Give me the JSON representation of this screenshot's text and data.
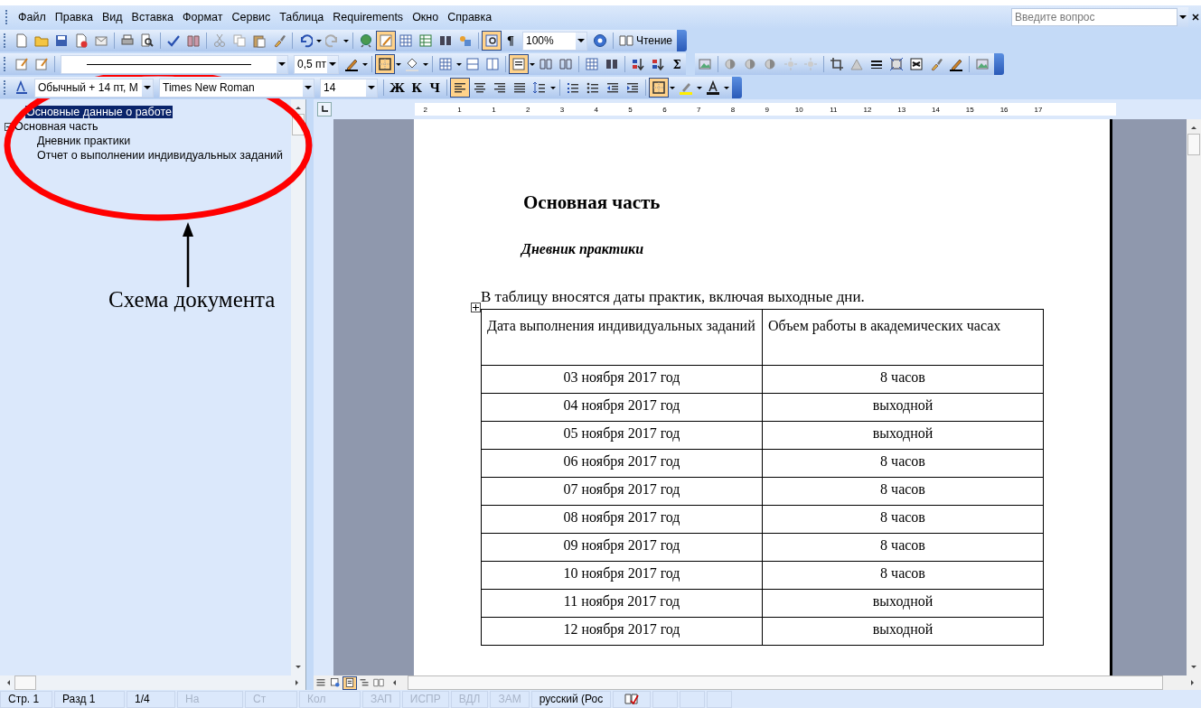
{
  "menu": [
    "Файл",
    "Правка",
    "Вид",
    "Вставка",
    "Формат",
    "Сервис",
    "Таблица",
    "Requirements",
    "Окно",
    "Справка"
  ],
  "help_search": {
    "placeholder": "Введите вопрос"
  },
  "toolbars": [
    {
      "items": [
        {
          "kind": "new",
          "selected": false
        },
        {
          "kind": "open",
          "selected": false
        },
        {
          "kind": "save",
          "selected": false
        },
        {
          "kind": "permission",
          "selected": false
        },
        {
          "kind": "email",
          "selected": false
        },
        {
          "kind": "sep"
        },
        {
          "kind": "print",
          "selected": false
        },
        {
          "kind": "preview",
          "selected": false
        },
        {
          "kind": "sep"
        },
        {
          "kind": "spelling",
          "selected": false
        },
        {
          "kind": "research",
          "selected": false
        },
        {
          "kind": "sep"
        },
        {
          "kind": "cut",
          "selected": false
        },
        {
          "kind": "copy",
          "selected": false
        },
        {
          "kind": "paste",
          "selected": false
        },
        {
          "kind": "brush",
          "selected": false
        },
        {
          "kind": "sep"
        },
        {
          "kind": "undo",
          "selected": false
        },
        {
          "kind": "arrow"
        },
        {
          "kind": "redo",
          "selected": false
        },
        {
          "kind": "arrow"
        },
        {
          "kind": "sep"
        },
        {
          "kind": "globe",
          "selected": false
        },
        {
          "kind": "tablepen",
          "selected": true
        },
        {
          "kind": "table",
          "selected": false
        },
        {
          "kind": "excel",
          "selected": false
        },
        {
          "kind": "columns",
          "selected": false
        },
        {
          "kind": "drawing",
          "selected": false
        },
        {
          "kind": "sep"
        },
        {
          "kind": "docmap",
          "selected": true
        },
        {
          "kind": "text",
          "label": "¶",
          "selected": false
        },
        {
          "kind": "field",
          "value": "100%"
        },
        {
          "kind": "help",
          "selected": false
        },
        {
          "kind": "sep"
        },
        {
          "kind": "reading",
          "label": "Чтение",
          "selected": false
        }
      ]
    },
    {
      "items": [
        {
          "kind": "form",
          "selected": false
        },
        {
          "kind": "form",
          "selected": false
        },
        {
          "kind": "sep"
        },
        {
          "kind": "linefield"
        },
        {
          "kind": "field",
          "value": "0,5 пт"
        },
        {
          "kind": "pen",
          "selected": false
        },
        {
          "kind": "arrow"
        },
        {
          "kind": "sep"
        },
        {
          "kind": "border",
          "selected": true
        },
        {
          "kind": "arrow"
        },
        {
          "kind": "bucket",
          "selected": false
        },
        {
          "kind": "arrow"
        },
        {
          "kind": "sep"
        },
        {
          "kind": "table",
          "selected": false
        },
        {
          "kind": "arrow"
        },
        {
          "kind": "merge",
          "selected": false
        },
        {
          "kind": "split",
          "selected": false
        },
        {
          "kind": "sep"
        },
        {
          "kind": "align",
          "selected": true
        },
        {
          "kind": "arrow"
        },
        {
          "kind": "distribute",
          "selected": false
        },
        {
          "kind": "distribute",
          "selected": false
        },
        {
          "kind": "sep"
        },
        {
          "kind": "table",
          "selected": false
        },
        {
          "kind": "columns",
          "selected": false
        },
        {
          "kind": "sep"
        },
        {
          "kind": "sortup",
          "selected": false
        },
        {
          "kind": "sortdown",
          "selected": false
        },
        {
          "kind": "text",
          "label": "Σ",
          "selected": false
        },
        {
          "kind": "gap"
        },
        {
          "kind": "picture",
          "selected": false
        },
        {
          "kind": "sep"
        },
        {
          "kind": "contrast",
          "selected": false
        },
        {
          "kind": "contrast",
          "selected": false
        },
        {
          "kind": "contrast",
          "selected": false
        },
        {
          "kind": "sun",
          "selected": false
        },
        {
          "kind": "sun",
          "selected": false
        },
        {
          "kind": "sep"
        },
        {
          "kind": "crop",
          "selected": false
        },
        {
          "kind": "rotate",
          "selected": false
        },
        {
          "kind": "lines",
          "selected": false
        },
        {
          "kind": "compress",
          "selected": false
        },
        {
          "kind": "wrap",
          "selected": false
        },
        {
          "kind": "brush",
          "selected": false
        },
        {
          "kind": "pen",
          "selected": false
        },
        {
          "kind": "sep"
        },
        {
          "kind": "picture",
          "selected": false
        }
      ]
    },
    {
      "items": [
        {
          "kind": "styles",
          "selected": false
        },
        {
          "kind": "field",
          "value": "Обычный + 14 пт, М"
        },
        {
          "kind": "field",
          "value": "Times New Roman"
        },
        {
          "kind": "field",
          "value": "14"
        },
        {
          "kind": "sep"
        },
        {
          "kind": "text",
          "label": "Ж",
          "selected": false
        },
        {
          "kind": "text",
          "label": "К",
          "selected": false
        },
        {
          "kind": "text",
          "label": "Ч",
          "selected": false
        },
        {
          "kind": "sep"
        },
        {
          "kind": "alignleft",
          "selected": true
        },
        {
          "kind": "aligncenter",
          "selected": false
        },
        {
          "kind": "alignright",
          "selected": false
        },
        {
          "kind": "justify",
          "selected": false
        },
        {
          "kind": "spacing",
          "selected": false
        },
        {
          "kind": "arrow"
        },
        {
          "kind": "sep"
        },
        {
          "kind": "numbering",
          "selected": false
        },
        {
          "kind": "bullets",
          "selected": false
        },
        {
          "kind": "outdent",
          "selected": false
        },
        {
          "kind": "indent",
          "selected": false
        },
        {
          "kind": "sep"
        },
        {
          "kind": "border",
          "selected": true
        },
        {
          "kind": "arrow"
        },
        {
          "kind": "highlight",
          "selected": false
        },
        {
          "kind": "arrow"
        },
        {
          "kind": "fontcolor",
          "selected": false
        },
        {
          "kind": "arrow"
        }
      ]
    }
  ],
  "document_map": {
    "items": [
      {
        "label": "Основные данные о работе",
        "selected": true
      },
      {
        "label": "Основная часть",
        "selected": false,
        "expanded": true,
        "children": [
          {
            "label": "Дневник практики",
            "selected": false
          },
          {
            "label": "Отчет о выполнении индивидуальных заданий",
            "selected": false
          }
        ]
      }
    ]
  },
  "annotation": {
    "caption": "Схема документа"
  },
  "ruler": {
    "marks": [
      "2",
      "1",
      "1",
      "2",
      "3",
      "4",
      "5",
      "6",
      "7",
      "8",
      "9",
      "10",
      "11",
      "12",
      "13",
      "14",
      "15",
      "16",
      "17"
    ]
  },
  "document": {
    "heading": "Основная часть",
    "subheading": "Дневник практики",
    "paragraph": "В таблицу вносятся даты практик, включая выходные дни.",
    "table": {
      "columns": [
        "Дата выполнения индивидуальных заданий",
        "Объем работы в академических часах"
      ],
      "rows": [
        [
          "03 ноября 2017 год",
          "8 часов"
        ],
        [
          "04 ноября 2017 год",
          "выходной"
        ],
        [
          "05 ноября 2017 год",
          "выходной"
        ],
        [
          "06 ноября 2017 год",
          "8 часов"
        ],
        [
          "07 ноября 2017 год",
          "8 часов"
        ],
        [
          "08 ноября 2017 год",
          "8 часов"
        ],
        [
          "09 ноября 2017 год",
          "8 часов"
        ],
        [
          "10 ноября 2017 год",
          "8 часов"
        ],
        [
          "11 ноября 2017 год",
          "выходной"
        ],
        [
          "12 ноября 2017 год",
          "выходной"
        ]
      ]
    }
  },
  "view_buttons": [
    {
      "kind": "normal",
      "selected": false
    },
    {
      "kind": "web",
      "selected": false
    },
    {
      "kind": "layout",
      "selected": true
    },
    {
      "kind": "outline",
      "selected": false
    },
    {
      "kind": "reading",
      "selected": false
    }
  ],
  "status_bar": [
    {
      "text": "Стр. 1",
      "on": true
    },
    {
      "text": "Разд 1",
      "on": true
    },
    {
      "text": "1/4",
      "on": true
    },
    {
      "text": "На",
      "on": false
    },
    {
      "text": "Ст",
      "on": false
    },
    {
      "text": "Кол",
      "on": false
    },
    {
      "text": "ЗАП",
      "on": false
    },
    {
      "text": "ИСПР",
      "on": false
    },
    {
      "text": "ВДЛ",
      "on": false
    },
    {
      "text": "ЗАМ",
      "on": false
    },
    {
      "text": "русский (Рос",
      "on": true
    }
  ]
}
